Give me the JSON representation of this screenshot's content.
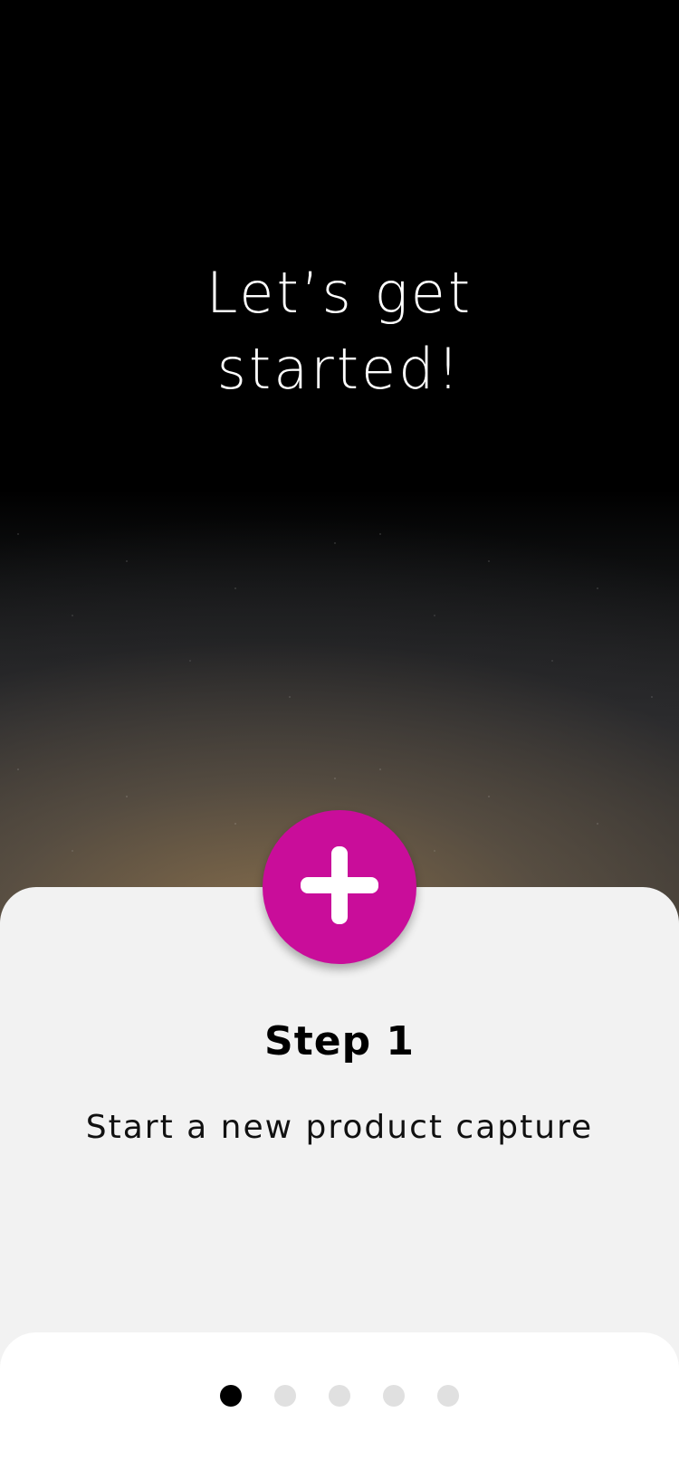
{
  "hero": {
    "title_line1": "Let’s get",
    "title_line2": "started!"
  },
  "fab": {
    "icon": "plus-icon",
    "color": "#c90d9a"
  },
  "card": {
    "step_title": "Step 1",
    "step_description": "Start a new product capture"
  },
  "pagination": {
    "total": 5,
    "active_index": 0
  }
}
